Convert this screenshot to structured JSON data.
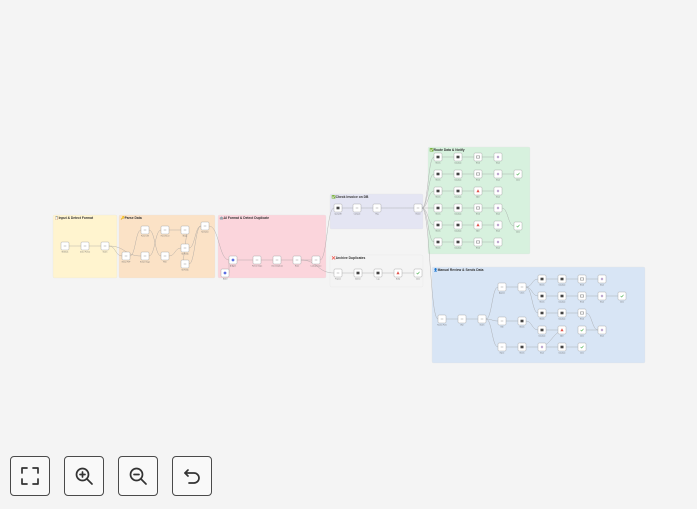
{
  "canvas": {
    "stickies": [
      {
        "id": "input",
        "title": "📋Input & Detect Format",
        "color": "#fff4cf"
      },
      {
        "id": "parse",
        "title": "🔑Parse Data",
        "color": "#fbe2c6"
      },
      {
        "id": "ai",
        "title": "🤖AI Format & Detect Duplicate",
        "color": "#fbd5dc"
      },
      {
        "id": "check",
        "title": "✅Check Invoice on DB",
        "color": "#e4e5f3"
      },
      {
        "id": "archive",
        "title": "❌Archive Duplicates",
        "color": "#f4f4f4"
      },
      {
        "id": "route",
        "title": "✅Route Data & Notify",
        "color": "#d7f1de"
      },
      {
        "id": "manual",
        "title": "👤Manual Review & Sends Data",
        "color": "#d8e5f5"
      }
    ],
    "nodes": [
      {
        "id": "n1",
        "label": "Webhook",
        "icon": "webhook-icon"
      },
      {
        "id": "n2",
        "label": "Detect Format",
        "icon": "code-icon"
      },
      {
        "id": "n3",
        "label": "Switch",
        "icon": "switch-icon"
      },
      {
        "id": "n4",
        "label": "Extract PDF",
        "icon": "file-icon"
      },
      {
        "id": "n5",
        "label": "Extract Image",
        "icon": "file-icon"
      },
      {
        "id": "n6",
        "label": "Parse CSV",
        "icon": "file-icon"
      },
      {
        "id": "n7",
        "label": "Parse Excel",
        "icon": "file-icon"
      },
      {
        "id": "n8",
        "label": "Filter",
        "icon": "filter-icon"
      },
      {
        "id": "n9",
        "label": "Merge",
        "icon": "merge-icon"
      },
      {
        "id": "n10",
        "label": "Set Fields",
        "icon": "code-icon"
      },
      {
        "id": "n11",
        "label": "Set Fields",
        "icon": "code-icon"
      },
      {
        "id": "n12",
        "label": "Normalize",
        "icon": "code-icon"
      },
      {
        "id": "n13",
        "label": "Model",
        "icon": "ai-icon"
      },
      {
        "id": "n14",
        "label": "AI Agent",
        "icon": "ai-icon"
      },
      {
        "id": "n15",
        "label": "Format Output",
        "icon": "code-icon"
      },
      {
        "id": "n16",
        "label": "Check Duplicate",
        "icon": "code-icon"
      },
      {
        "id": "n17",
        "label": "Route",
        "icon": "code-icon"
      },
      {
        "id": "n18",
        "label": "Lookup Invoice",
        "icon": "code-icon"
      },
      {
        "id": "n19",
        "label": "Query DB",
        "icon": "database-icon"
      },
      {
        "id": "n20",
        "label": "Compare",
        "icon": "code-icon"
      },
      {
        "id": "n21",
        "label": "Flag",
        "icon": "code-icon"
      },
      {
        "id": "n22",
        "label": "Router",
        "icon": "switch-icon"
      },
      {
        "id": "n23",
        "label": "Prepare",
        "icon": "code-icon"
      },
      {
        "id": "n24",
        "label": "Archive",
        "icon": "database-icon"
      },
      {
        "id": "n25",
        "label": "Log",
        "icon": "database-icon"
      },
      {
        "id": "n26",
        "label": "Notify",
        "icon": "alert-icon"
      },
      {
        "id": "n27",
        "label": "Done",
        "icon": "check-icon"
      },
      {
        "id": "r1",
        "label": "Sheets",
        "icon": "sheet-icon"
      },
      {
        "id": "r2",
        "label": "Database",
        "icon": "database-icon"
      },
      {
        "id": "r3",
        "label": "Email",
        "icon": "mail-icon"
      },
      {
        "id": "r4",
        "label": "Slack",
        "icon": "slack-icon"
      },
      {
        "id": "r5",
        "label": "Sheets",
        "icon": "sheet-icon"
      },
      {
        "id": "r6",
        "label": "Database",
        "icon": "database-icon"
      },
      {
        "id": "r7",
        "label": "Email",
        "icon": "mail-icon"
      },
      {
        "id": "r8",
        "label": "Slack",
        "icon": "slack-icon"
      },
      {
        "id": "r9",
        "label": "Sheets",
        "icon": "sheet-icon"
      },
      {
        "id": "r10",
        "label": "Database",
        "icon": "database-icon"
      },
      {
        "id": "r11",
        "label": "Alert",
        "icon": "alert-icon"
      },
      {
        "id": "r12",
        "label": "Slack",
        "icon": "slack-icon"
      },
      {
        "id": "r13",
        "label": "Sheets",
        "icon": "sheet-icon"
      },
      {
        "id": "r14",
        "label": "Database",
        "icon": "database-icon"
      },
      {
        "id": "r15",
        "label": "Email",
        "icon": "mail-icon"
      },
      {
        "id": "r16",
        "label": "Slack",
        "icon": "slack-icon"
      },
      {
        "id": "r17",
        "label": "Sheets",
        "icon": "sheet-icon"
      },
      {
        "id": "r18",
        "label": "Database",
        "icon": "database-icon"
      },
      {
        "id": "r19",
        "label": "Alert",
        "icon": "alert-icon"
      },
      {
        "id": "r20",
        "label": "Slack",
        "icon": "slack-icon"
      },
      {
        "id": "r21",
        "label": "Sheets",
        "icon": "sheet-icon"
      },
      {
        "id": "r22",
        "label": "Database",
        "icon": "database-icon"
      },
      {
        "id": "r23",
        "label": "Email",
        "icon": "mail-icon"
      },
      {
        "id": "r24",
        "label": "Slack",
        "icon": "slack-icon"
      },
      {
        "id": "r25",
        "label": "Done",
        "icon": "check-icon"
      },
      {
        "id": "r26",
        "label": "Done",
        "icon": "check-icon"
      },
      {
        "id": "m1",
        "label": "Review Form",
        "icon": "form-icon"
      },
      {
        "id": "m2",
        "label": "Wait",
        "icon": "code-icon"
      },
      {
        "id": "m3",
        "label": "Switch",
        "icon": "switch-icon"
      },
      {
        "id": "m4",
        "label": "Approve",
        "icon": "code-icon"
      },
      {
        "id": "m5",
        "label": "Edit",
        "icon": "code-icon"
      },
      {
        "id": "m6",
        "label": "Reject",
        "icon": "code-icon"
      },
      {
        "id": "m7",
        "label": "Check",
        "icon": "form-icon"
      },
      {
        "id": "m8",
        "label": "Sheets",
        "icon": "sheet-icon"
      },
      {
        "id": "m9",
        "label": "Database",
        "icon": "database-icon"
      },
      {
        "id": "m10",
        "label": "Email",
        "icon": "mail-icon"
      },
      {
        "id": "m11",
        "label": "Slack",
        "icon": "slack-icon"
      },
      {
        "id": "m12",
        "label": "Sheets",
        "icon": "sheet-icon"
      },
      {
        "id": "m13",
        "label": "Database",
        "icon": "database-icon"
      },
      {
        "id": "m14",
        "label": "Email",
        "icon": "mail-icon"
      },
      {
        "id": "m15",
        "label": "Slack",
        "icon": "slack-icon"
      },
      {
        "id": "m16",
        "label": "Done",
        "icon": "check-icon"
      },
      {
        "id": "m17",
        "label": "Sheets",
        "icon": "sheet-icon"
      },
      {
        "id": "m18",
        "label": "Database",
        "icon": "database-icon"
      },
      {
        "id": "m19",
        "label": "Email",
        "icon": "mail-icon"
      },
      {
        "id": "m20",
        "label": "Slack",
        "icon": "slack-icon"
      },
      {
        "id": "m21",
        "label": "Done",
        "icon": "check-icon"
      },
      {
        "id": "m22",
        "label": "Sheets",
        "icon": "sheet-icon"
      },
      {
        "id": "m23",
        "label": "Database",
        "icon": "database-icon"
      },
      {
        "id": "m24",
        "label": "Alert",
        "icon": "alert-icon"
      },
      {
        "id": "m25",
        "label": "Slack",
        "icon": "slack-icon"
      },
      {
        "id": "m26",
        "label": "Sheets",
        "icon": "sheet-icon"
      },
      {
        "id": "m27",
        "label": "Database",
        "icon": "database-icon"
      },
      {
        "id": "m28",
        "label": "Done",
        "icon": "check-icon"
      }
    ],
    "edges": [
      [
        "n1",
        "n2"
      ],
      [
        "n2",
        "n3"
      ],
      [
        "n3",
        "n4"
      ],
      [
        "n3",
        "n5"
      ],
      [
        "n4",
        "n6"
      ],
      [
        "n5",
        "n7"
      ],
      [
        "n6",
        "n8"
      ],
      [
        "n7",
        "n9"
      ],
      [
        "n8",
        "n10"
      ],
      [
        "n9",
        "n11"
      ],
      [
        "n10",
        "n12"
      ],
      [
        "n11",
        "n12"
      ],
      [
        "n12",
        "n14"
      ],
      [
        "n13",
        "n14"
      ],
      [
        "n14",
        "n15"
      ],
      [
        "n15",
        "n16"
      ],
      [
        "n16",
        "n17"
      ],
      [
        "n17",
        "n18"
      ],
      [
        "n18",
        "n19"
      ],
      [
        "n19",
        "n20"
      ],
      [
        "n20",
        "n21"
      ],
      [
        "n21",
        "n22"
      ],
      [
        "n17",
        "n23"
      ],
      [
        "n23",
        "n24"
      ],
      [
        "n24",
        "n25"
      ],
      [
        "n25",
        "n26"
      ],
      [
        "n26",
        "n27"
      ],
      [
        "n22",
        "r1"
      ],
      [
        "n22",
        "r5"
      ],
      [
        "n22",
        "r9"
      ],
      [
        "n22",
        "r13"
      ],
      [
        "n22",
        "r17"
      ],
      [
        "n22",
        "r21"
      ],
      [
        "r1",
        "r2"
      ],
      [
        "r2",
        "r3"
      ],
      [
        "r3",
        "r4"
      ],
      [
        "r5",
        "r6"
      ],
      [
        "r6",
        "r7"
      ],
      [
        "r7",
        "r8"
      ],
      [
        "r8",
        "r25"
      ],
      [
        "r9",
        "r10"
      ],
      [
        "r10",
        "r11"
      ],
      [
        "r11",
        "r12"
      ],
      [
        "r13",
        "r14"
      ],
      [
        "r14",
        "r15"
      ],
      [
        "r15",
        "r16"
      ],
      [
        "r16",
        "r26"
      ],
      [
        "r17",
        "r18"
      ],
      [
        "r18",
        "r19"
      ],
      [
        "r19",
        "r20"
      ],
      [
        "r21",
        "r22"
      ],
      [
        "r22",
        "r23"
      ],
      [
        "r23",
        "r24"
      ],
      [
        "n22",
        "m1"
      ],
      [
        "m1",
        "m2"
      ],
      [
        "m2",
        "m3"
      ],
      [
        "m3",
        "m4"
      ],
      [
        "m3",
        "m5"
      ],
      [
        "m3",
        "m6"
      ],
      [
        "m4",
        "m7"
      ],
      [
        "m7",
        "m8"
      ],
      [
        "m7",
        "m12"
      ],
      [
        "m7",
        "m17"
      ],
      [
        "m8",
        "m9"
      ],
      [
        "m9",
        "m10"
      ],
      [
        "m10",
        "m11"
      ],
      [
        "m12",
        "m13"
      ],
      [
        "m13",
        "m14"
      ],
      [
        "m14",
        "m15"
      ],
      [
        "m15",
        "m16"
      ],
      [
        "m17",
        "m18"
      ],
      [
        "m18",
        "m19"
      ],
      [
        "m19",
        "m20"
      ],
      [
        "m20",
        "m21"
      ],
      [
        "m5",
        "m22"
      ],
      [
        "m22",
        "m23"
      ],
      [
        "m23",
        "m24"
      ],
      [
        "m24",
        "m25"
      ],
      [
        "m6",
        "m26"
      ],
      [
        "m26",
        "m27"
      ],
      [
        "m27",
        "m28"
      ]
    ]
  },
  "controls": [
    {
      "id": "fit",
      "label": "Fit view",
      "icon": "fit-view-icon"
    },
    {
      "id": "zoom-in",
      "label": "Zoom in",
      "icon": "zoom-in-icon"
    },
    {
      "id": "zoom-out",
      "label": "Zoom out",
      "icon": "zoom-out-icon"
    },
    {
      "id": "reset",
      "label": "Reset zoom",
      "icon": "undo-icon"
    }
  ],
  "colors": {
    "background": "#f4f4f4",
    "edge": "#9a9a9a",
    "node_border": "#8f8f8f",
    "control_border": "#4a4a4a",
    "alert": "#e0574f",
    "check": "#4caf50",
    "ai": "#5b6ee1"
  }
}
